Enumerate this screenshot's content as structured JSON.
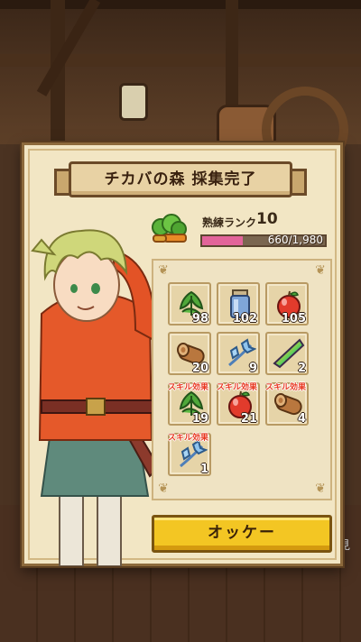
{
  "dialog": {
    "title": "チカバの森 採集完了",
    "rank_label": "熟練ランク",
    "rank_value": "10",
    "rank_exp": "660/1,980",
    "rank_progress": 0.333,
    "ok_label": "オッケー"
  },
  "side_note": "見",
  "items": [
    {
      "icon": "herb-leaf-icon",
      "count": "98",
      "bonus": ""
    },
    {
      "icon": "water-jar-icon",
      "count": "102",
      "bonus": ""
    },
    {
      "icon": "apple-icon",
      "count": "105",
      "bonus": ""
    },
    {
      "icon": "wood-log-icon",
      "count": "20",
      "bonus": ""
    },
    {
      "icon": "blue-flower-icon",
      "count": "9",
      "bonus": ""
    },
    {
      "icon": "rainbow-crystal-icon",
      "count": "2",
      "bonus": ""
    },
    {
      "icon": "herb-leaf-icon",
      "count": "19",
      "bonus": "スキル効果"
    },
    {
      "icon": "apple-icon",
      "count": "21",
      "bonus": "スキル効果"
    },
    {
      "icon": "wood-log-icon",
      "count": "4",
      "bonus": "スキル効果"
    },
    {
      "icon": "blue-flower-icon",
      "count": "1",
      "bonus": "スキル効果"
    }
  ],
  "colors": {
    "panel": "#f2e6c4",
    "button": "#f3c623",
    "rank_bar_fill": "#e2649a",
    "bonus_text": "#e8361f"
  }
}
